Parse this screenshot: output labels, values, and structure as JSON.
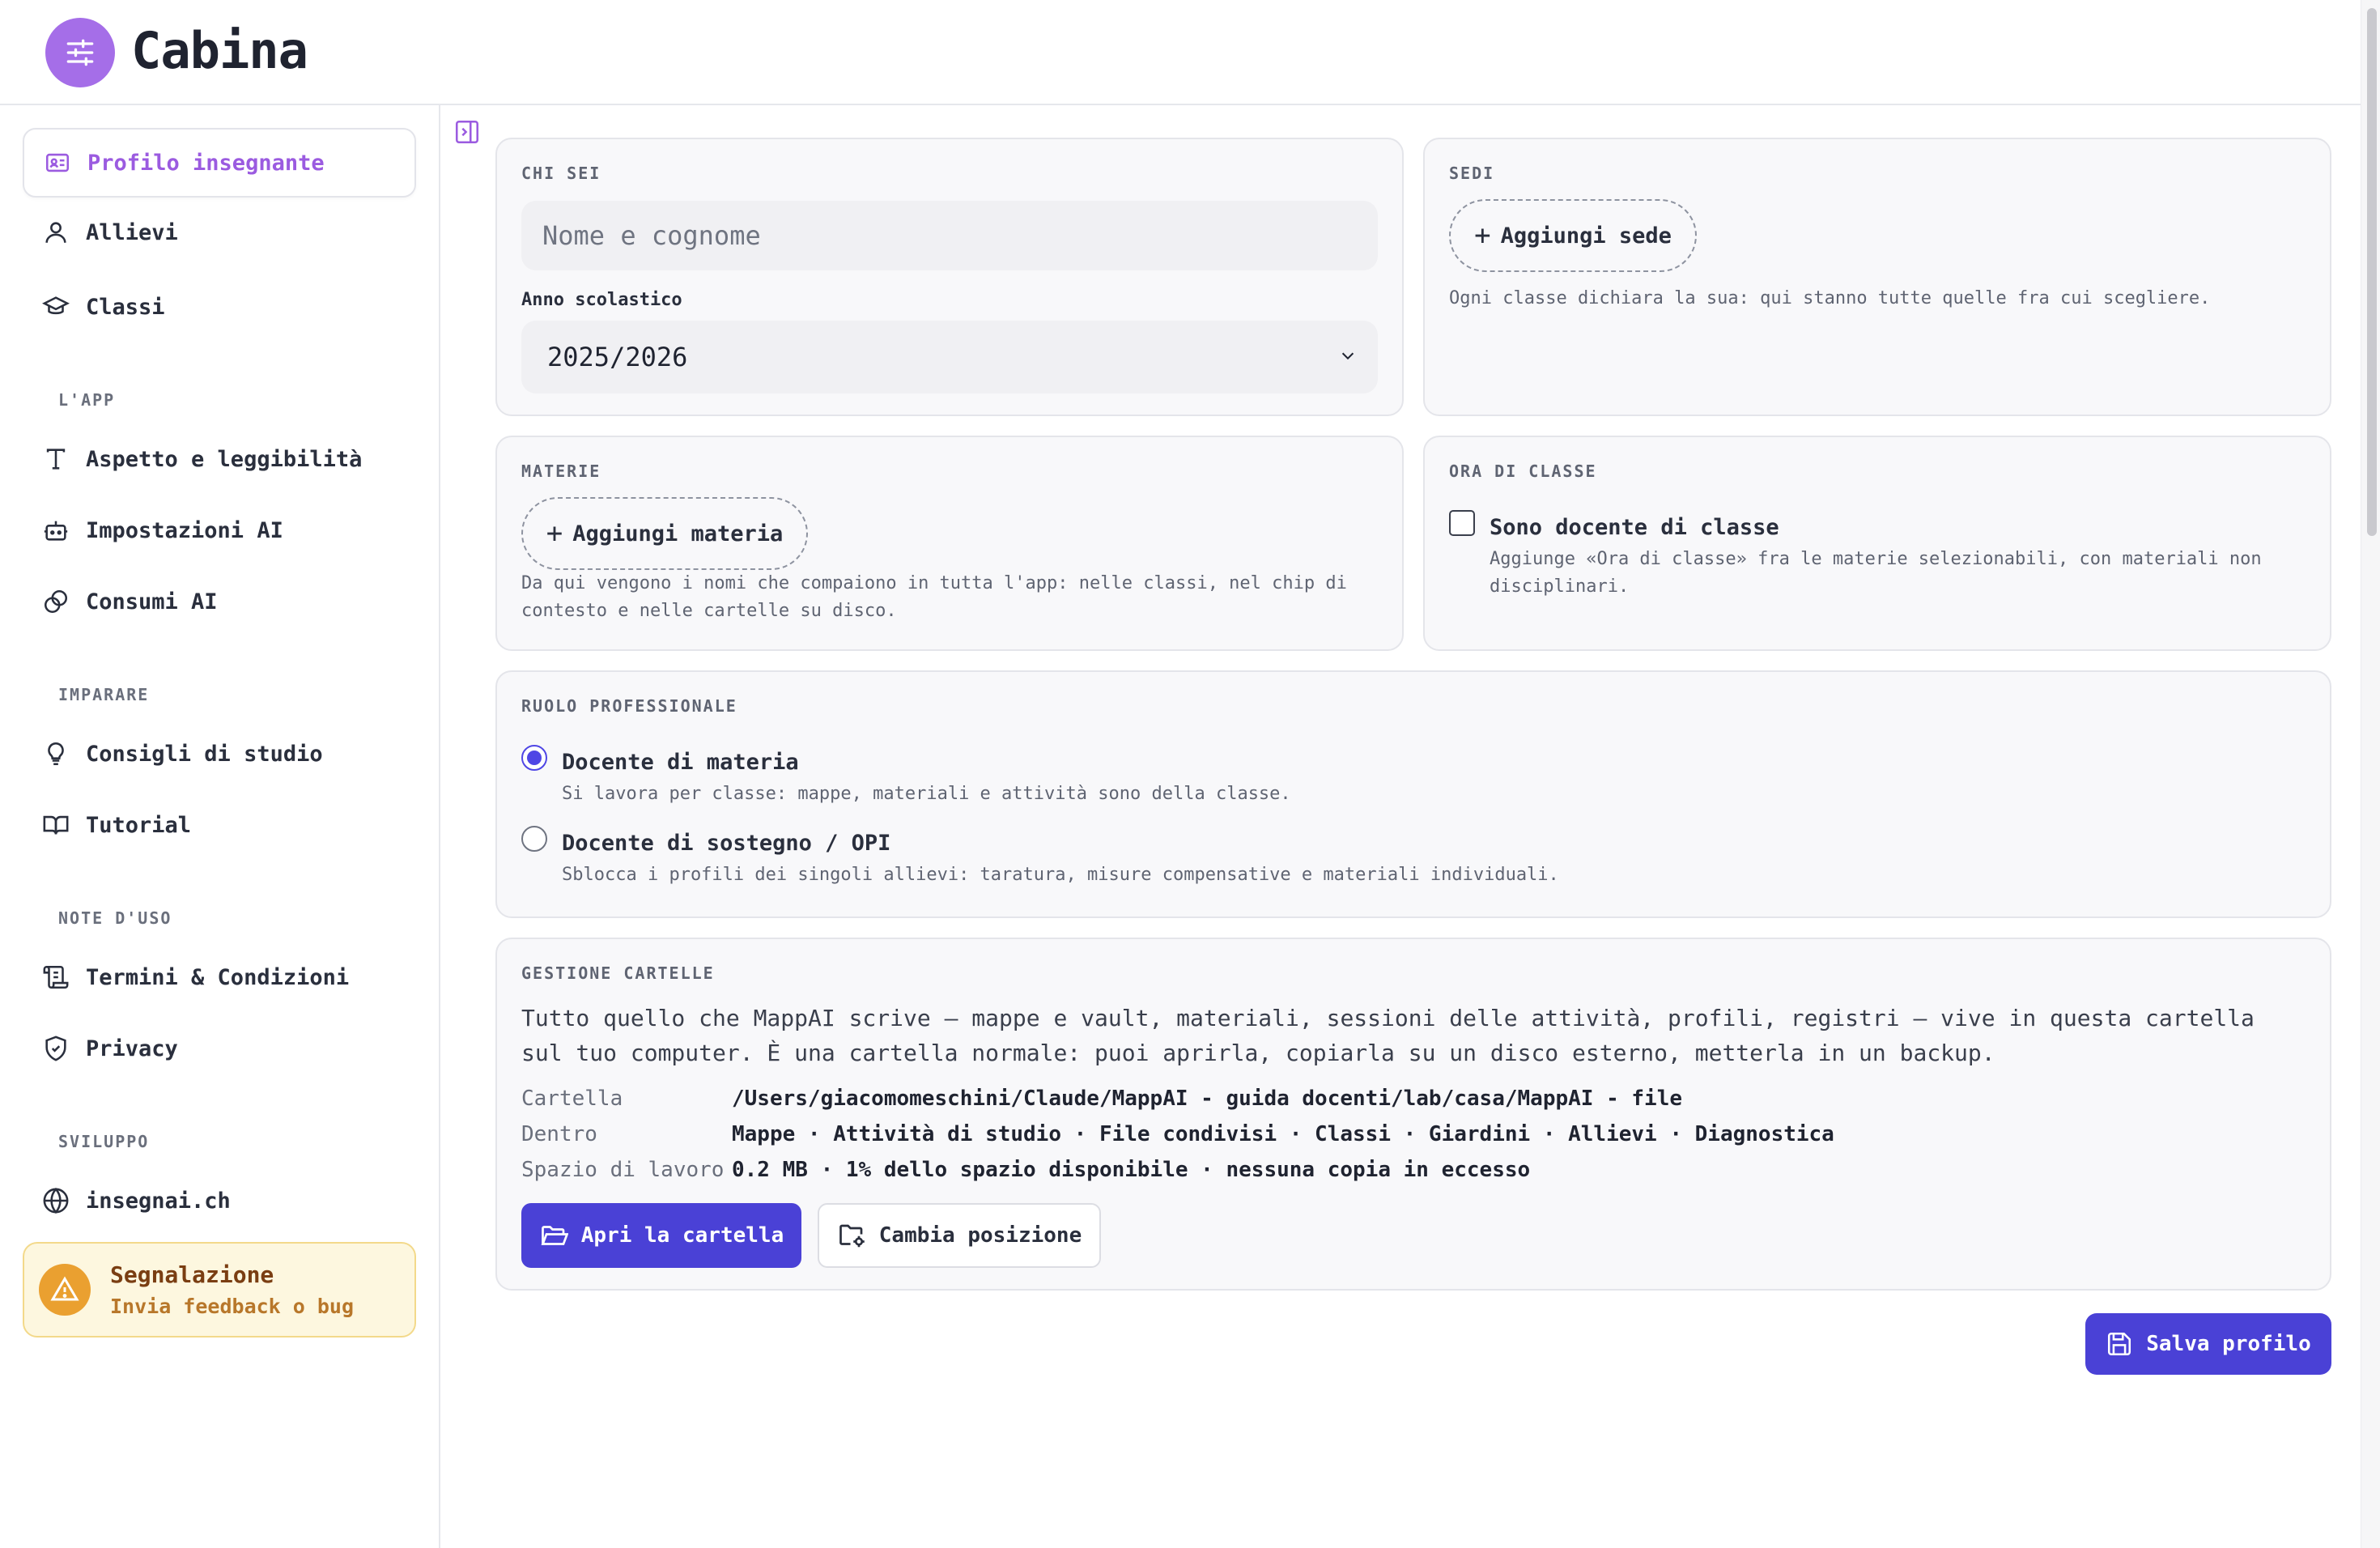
{
  "app": {
    "title": "Cabina",
    "logo_icon": "sliders-icon"
  },
  "sidebar": {
    "items": [
      {
        "label": "Profilo insegnante",
        "icon": "id-card-icon",
        "active": true
      },
      {
        "label": "Allievi",
        "icon": "user-icon"
      },
      {
        "label": "Classi",
        "icon": "graduation-cap-icon"
      },
      {
        "label": "Aspetto e leggibilità",
        "icon": "type-icon"
      },
      {
        "label": "Impostazioni AI",
        "icon": "robot-icon"
      },
      {
        "label": "Consumi AI",
        "icon": "coins-icon"
      },
      {
        "label": "Consigli di studio",
        "icon": "lightbulb-icon"
      },
      {
        "label": "Tutorial",
        "icon": "book-icon"
      },
      {
        "label": "Termini & Condizioni",
        "icon": "scroll-icon"
      },
      {
        "label": "Privacy",
        "icon": "shield-icon"
      },
      {
        "label": "insegnai.ch",
        "icon": "globe-icon"
      }
    ],
    "sections": [
      "L'APP",
      "IMPARARE",
      "NOTE D'USO",
      "SVILUPPO"
    ],
    "report": {
      "title": "Segnalazione",
      "subtitle": "Invia feedback o bug",
      "icon": "warning-icon"
    }
  },
  "cards": {
    "chi_sei": {
      "label": "CHI SEI",
      "name_placeholder": "Nome e cognome",
      "year_label": "Anno scolastico",
      "year_value": "2025/2026"
    },
    "sedi": {
      "label": "SEDI",
      "add_label": "Aggiungi sede",
      "help": "Ogni classe dichiara la sua: qui stanno tutte quelle fra cui scegliere."
    },
    "materie": {
      "label": "MATERIE",
      "add_label": "Aggiungi materia",
      "help": "Da qui vengono i nomi che compaiono in tutta l'app: nelle classi, nel chip di contesto e nelle cartelle su disco."
    },
    "ora_classe": {
      "label": "ORA DI CLASSE",
      "checkbox_label": "Sono docente di classe",
      "checked": false,
      "help": "Aggiunge «Ora di classe» fra le materie selezionabili, con materiali non disciplinari."
    },
    "ruolo": {
      "label": "RUOLO PROFESSIONALE",
      "options": [
        {
          "title": "Docente di materia",
          "desc": "Si lavora per classe: mappe, materiali e attività sono della classe.",
          "selected": true
        },
        {
          "title": "Docente di sostegno / OPI",
          "desc": "Sblocca i profili dei singoli allievi: taratura, misure compensative e materiali individuali.",
          "selected": false
        }
      ]
    },
    "cartelle": {
      "label": "GESTIONE CARTELLE",
      "description": "Tutto quello che MappAI scrive — mappe e vault, materiali, sessioni delle attività, profili, registri — vive in questa cartella sul tuo computer. È una cartella normale: puoi aprirla, copiarla su un disco esterno, metterla in un backup.",
      "rows": [
        {
          "key": "Cartella",
          "value": "/Users/giacomomeschini/Claude/MappAI - guida docenti/lab/casa/MappAI - file"
        },
        {
          "key": "Dentro",
          "value": "Mappe · Attività di studio · File condivisi · Classi · Giardini · Allievi · Diagnostica"
        },
        {
          "key": "Spazio di lavoro",
          "value": "0.2 MB · 1% dello spazio disponibile · nessuna copia in eccesso"
        }
      ],
      "open_label": "Apri la cartella",
      "move_label": "Cambia posizione"
    }
  },
  "actions": {
    "save_label": "Salva profilo"
  },
  "colors": {
    "accent": "#4a41d6",
    "brand": "#a56ee8",
    "active_nav": "#9b5be0",
    "warning": "#eaa030"
  }
}
